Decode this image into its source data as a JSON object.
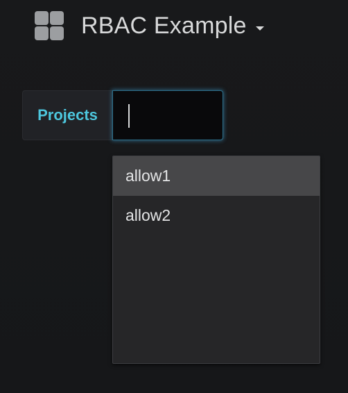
{
  "header": {
    "dashboard_title": "RBAC Example",
    "icon": "grid-icon"
  },
  "variable": {
    "label": "Projects",
    "input_value": "",
    "options": [
      {
        "label": "allow1",
        "highlighted": true
      },
      {
        "label": "allow2",
        "highlighted": false
      }
    ]
  },
  "colors": {
    "accent": "#4dc7de",
    "background": "#161719",
    "dropdown_bg": "#262628",
    "highlight_bg": "#474749",
    "input_glow": "#3e98c4"
  }
}
